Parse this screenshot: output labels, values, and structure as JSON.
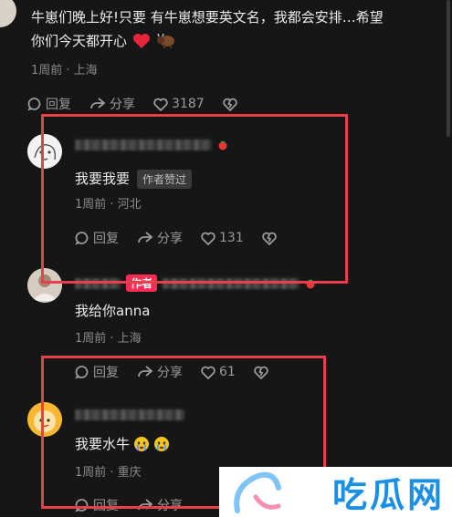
{
  "colors": {
    "background": "#161616",
    "highlight_box": "#e8404a",
    "author_tag": "#fe2c55",
    "watermark_text": "#1a8fe6"
  },
  "top_comment": {
    "text_line1": "牛崽们晚上好!只要 有牛崽想要英文名，我都会安排…希望",
    "text_line2": "你们今天都开心",
    "emojis": [
      "heart-icon",
      "bison-icon"
    ],
    "meta": "1周前 · 上海",
    "reply_label": "回复",
    "share_label": "分享",
    "likes": "3187"
  },
  "reply1": {
    "text": "我要我要",
    "tag": "作者赞过",
    "meta": "1周前 · 河北",
    "reply_label": "回复",
    "share_label": "分享",
    "likes": "131"
  },
  "reply2": {
    "author_tag": "作者",
    "text": "我给你anna",
    "meta": "1周前 · 上海",
    "reply_label": "回复",
    "share_label": "分享",
    "likes": "61"
  },
  "reply3": {
    "text": "我要水牛",
    "emojis": [
      "crying-face-icon",
      "crying-face-icon"
    ],
    "meta": "1周前 · 重庆",
    "reply_label": "回复",
    "share_label": "分享"
  },
  "watermark": {
    "text": "吃瓜网"
  }
}
